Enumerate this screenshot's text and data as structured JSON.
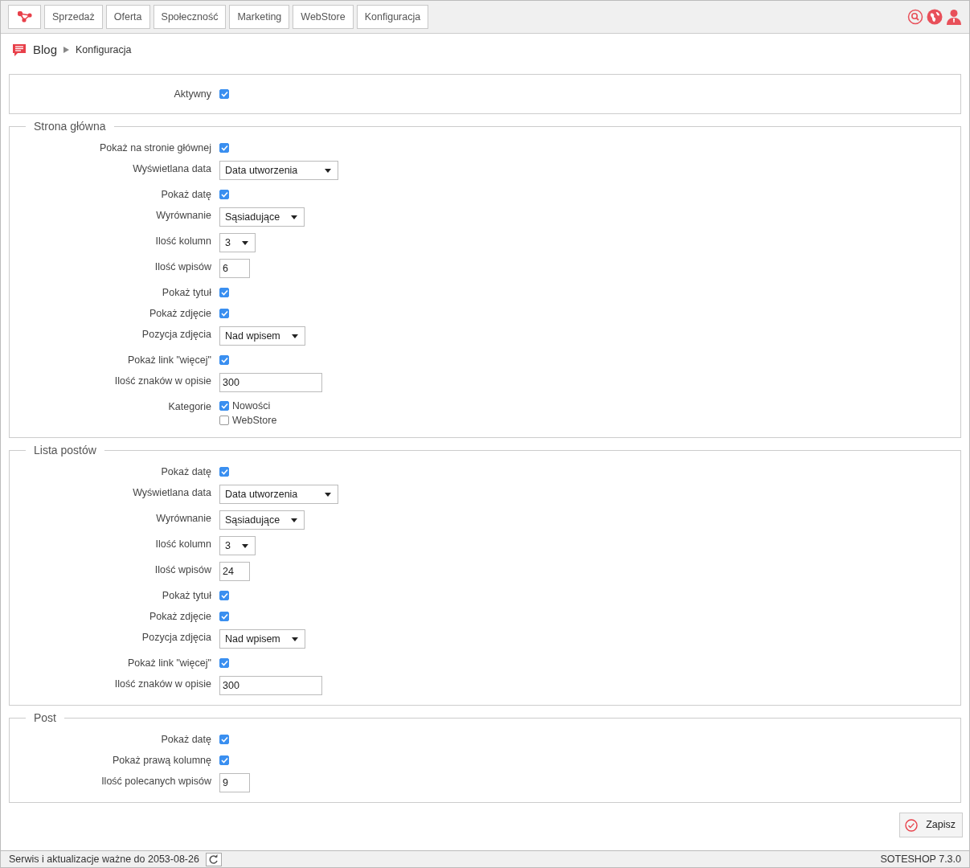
{
  "topbar": {
    "menu": [
      {
        "label": "Sprzedaż"
      },
      {
        "label": "Oferta"
      },
      {
        "label": "Społeczność"
      },
      {
        "label": "Marketing"
      },
      {
        "label": "WebStore"
      },
      {
        "label": "Konfiguracja"
      }
    ]
  },
  "breadcrumb": {
    "title": "Blog",
    "current": "Konfiguracja"
  },
  "sections": [
    {
      "fields": [
        {
          "label": "Aktywny",
          "kind": "checkbox",
          "checked": true
        }
      ]
    },
    {
      "legend": "Strona główna",
      "fields": [
        {
          "label": "Pokaż na stronie głównej",
          "kind": "checkbox",
          "checked": true
        },
        {
          "label": "Wyświetlana data",
          "kind": "select",
          "value": "Data utworzenia"
        },
        {
          "label": "Pokaż datę",
          "kind": "checkbox",
          "checked": true
        },
        {
          "label": "Wyrównanie",
          "kind": "select",
          "value": "Sąsiadujące"
        },
        {
          "label": "Ilość kolumn",
          "kind": "select",
          "value": "3"
        },
        {
          "label": "Ilość wpisów",
          "kind": "input",
          "value": "6"
        },
        {
          "label": "Pokaż tytuł",
          "kind": "checkbox",
          "checked": true
        },
        {
          "label": "Pokaż zdjęcie",
          "kind": "checkbox",
          "checked": true
        },
        {
          "label": "Pozycja zdjęcia",
          "kind": "select",
          "value": "Nad wpisem"
        },
        {
          "label": "Pokaż link \"więcej\"",
          "kind": "checkbox",
          "checked": true
        },
        {
          "label": "Ilość znaków w opisie",
          "kind": "input",
          "value": "300"
        },
        {
          "label": "Kategorie",
          "kind": "checklist",
          "options": [
            {
              "label": "Nowości",
              "checked": true
            },
            {
              "label": "WebStore",
              "checked": false
            }
          ]
        }
      ]
    },
    {
      "legend": "Lista postów",
      "fields": [
        {
          "label": "Pokaż datę",
          "kind": "checkbox",
          "checked": true
        },
        {
          "label": "Wyświetlana data",
          "kind": "select",
          "value": "Data utworzenia"
        },
        {
          "label": "Wyrównanie",
          "kind": "select",
          "value": "Sąsiadujące"
        },
        {
          "label": "Ilość kolumn",
          "kind": "select",
          "value": "3"
        },
        {
          "label": "Ilość wpisów",
          "kind": "input",
          "value": "24"
        },
        {
          "label": "Pokaż tytuł",
          "kind": "checkbox",
          "checked": true
        },
        {
          "label": "Pokaż zdjęcie",
          "kind": "checkbox",
          "checked": true
        },
        {
          "label": "Pozycja zdjęcia",
          "kind": "select",
          "value": "Nad wpisem"
        },
        {
          "label": "Pokaż link \"więcej\"",
          "kind": "checkbox",
          "checked": true
        },
        {
          "label": "Ilość znaków w opisie",
          "kind": "input",
          "value": "300"
        }
      ]
    },
    {
      "legend": "Post",
      "fields": [
        {
          "label": "Pokaż datę",
          "kind": "checkbox",
          "checked": true
        },
        {
          "label": "Pokaż prawą kolumnę",
          "kind": "checkbox",
          "checked": true
        },
        {
          "label": "Ilość polecanych wpisów",
          "kind": "input",
          "value": "9"
        }
      ]
    }
  ],
  "save_button": "Zapisz",
  "status_bar": {
    "license": "Serwis i aktualizacje ważne do 2053-08-26",
    "version": "SOTESHOP 7.3.0"
  }
}
